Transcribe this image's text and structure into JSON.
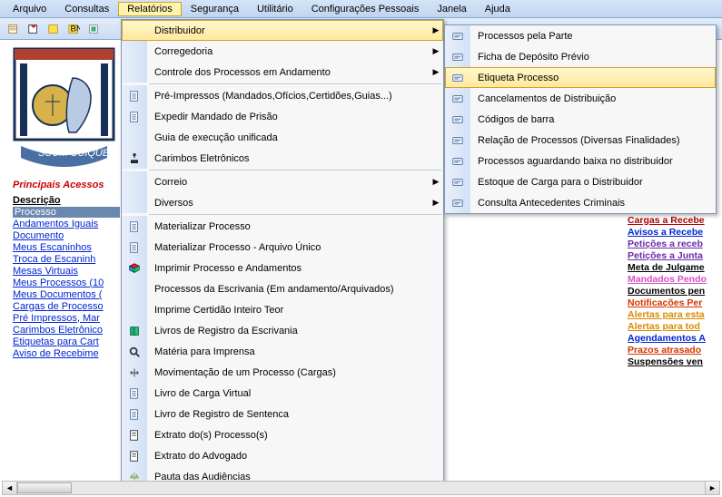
{
  "menubar": {
    "items": [
      "Arquivo",
      "Consultas",
      "Relatórios",
      "Segurança",
      "Utilitário",
      "Configurações Pessoais",
      "Janela",
      "Ajuda"
    ],
    "open_index": 2
  },
  "sidebar": {
    "title": "Principais Acessos",
    "heading": "Descrição",
    "links": [
      {
        "label": "Processo",
        "selected": true
      },
      {
        "label": "Andamentos Iguais"
      },
      {
        "label": "Documento"
      },
      {
        "label": "Meus Escaninhos"
      },
      {
        "label": "Troca de Escaninh"
      },
      {
        "label": "Mesas Virtuais"
      },
      {
        "label": "Meus Processos (10"
      },
      {
        "label": "Meus Documentos ("
      },
      {
        "label": "Cargas de Processo"
      },
      {
        "label": "Pré Impressos, Mar"
      },
      {
        "label": "Carimbos Eletrônico"
      },
      {
        "label": "Etiquetas para Cart"
      },
      {
        "label": "Aviso de Recebime"
      }
    ]
  },
  "rightcol": [
    {
      "label": "Cargas a Recebe",
      "color": "#b00000"
    },
    {
      "label": "Avisos a Recebe",
      "color": "#0025d0"
    },
    {
      "label": "Petições a receb",
      "color": "#6a2aa9"
    },
    {
      "label": "Petições a Junta",
      "color": "#6a2aa9"
    },
    {
      "label": "Meta de Julgame",
      "color": "#000"
    },
    {
      "label": "Mandados Pendo",
      "color": "#d84fbf"
    },
    {
      "label": "Documentos pen",
      "color": "#000"
    },
    {
      "label": "Notificações Per",
      "color": "#d43500"
    },
    {
      "label": "Alertas para esta",
      "color": "#d88a00"
    },
    {
      "label": "Alertas para tod",
      "color": "#d88a00"
    },
    {
      "label": "Agendamentos A",
      "color": "#0025d0"
    },
    {
      "label": "Prazos atrasado",
      "color": "#d43500"
    },
    {
      "label": "Suspensões ven",
      "color": "#000"
    }
  ],
  "menu1": [
    {
      "label": "Distribuidor",
      "arrow": true,
      "highlight": true
    },
    {
      "label": "Corregedoria",
      "arrow": true
    },
    {
      "label": "Controle dos Processos em Andamento",
      "arrow": true
    },
    {
      "sep": true
    },
    {
      "label": "Pré-Impressos (Mandados,Ofícios,Certidões,Guias...)",
      "icon": "doc"
    },
    {
      "label": "Expedir Mandado de Prisão",
      "icon": "doc"
    },
    {
      "label": "Guia de execução unificada"
    },
    {
      "label": "Carimbos Eletrônicos",
      "icon": "stamp"
    },
    {
      "sep": true
    },
    {
      "label": "Correio",
      "arrow": true
    },
    {
      "label": "Diversos",
      "arrow": true
    },
    {
      "sep": true
    },
    {
      "label": "Materializar Processo",
      "icon": "doc"
    },
    {
      "label": "Materializar Processo - Arquivo Único",
      "icon": "doc"
    },
    {
      "label": "Imprimir Processo e Andamentos",
      "icon": "cube"
    },
    {
      "label": "Processos da Escrivania (Em andamento/Arquivados)"
    },
    {
      "label": "Imprime Certidão Inteiro Teor"
    },
    {
      "label": "Livros de Registro da Escrivania",
      "icon": "book"
    },
    {
      "label": "Matéria para Imprensa",
      "icon": "mag"
    },
    {
      "label": "Movimentação de um Processo (Cargas)",
      "icon": "move"
    },
    {
      "label": "Livro de Carga Virtual",
      "icon": "doc"
    },
    {
      "label": "Livro de Registro de Sentenca",
      "icon": "doc"
    },
    {
      "label": "Extrato do(s) Processo(s)",
      "icon": "excerpt"
    },
    {
      "label": "Extrato do Advogado",
      "icon": "excerpt"
    },
    {
      "label": "Pauta das Audiências",
      "icon": "scale"
    }
  ],
  "menu2": [
    {
      "label": "Processos pela Parte",
      "icon": "card"
    },
    {
      "label": "Ficha de Depósito Prévio",
      "icon": "card"
    },
    {
      "label": "Etiqueta Processo",
      "icon": "card",
      "highlight": true
    },
    {
      "label": "Cancelamentos de Distribuição",
      "icon": "card"
    },
    {
      "label": "Códigos de barra",
      "icon": "card"
    },
    {
      "label": "Relação de Processos (Diversas Finalidades)",
      "icon": "card"
    },
    {
      "label": "Processos aguardando baixa no distribuidor",
      "icon": "card"
    },
    {
      "label": "Estoque de Carga para o Distribuidor",
      "icon": "card"
    },
    {
      "label": "Consulta Antecedentes Criminais",
      "icon": "card"
    }
  ]
}
